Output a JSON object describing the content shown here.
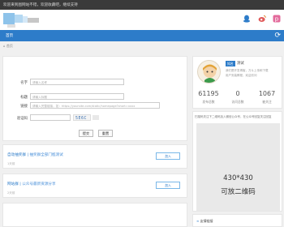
{
  "topbar": {
    "notice": "欢迎来到图网站不错，欢迎收藏吧，继续支持"
  },
  "nav": {
    "home": "首页",
    "refresh_icon": "refresh-icon"
  },
  "breadcrumb": "首页",
  "form": {
    "field1_label": "名字",
    "field1_placeholder": "请输入名称",
    "field2_label": "标题",
    "field2_placeholder": "请输入标题",
    "field3_label": "链接",
    "field3_placeholder": "请输入完整链接，如：https://yoursite.com/static/homepage?short=xxxx",
    "captcha_label": "验证码",
    "captcha_image_text": "5E6C",
    "submit_label": "提交",
    "reset_label": "重置"
  },
  "cards": [
    {
      "title": "自动抽奖群",
      "separator": " | ",
      "subtitle": "抽奖群全部门槛测试",
      "meta": "1天前",
      "action": "加入",
      "color": "#2d7cc9"
    },
    {
      "title": "网站群",
      "separator": " | ",
      "subtitle": "公众号最新资源分享",
      "meta": "2天前",
      "action": "加入",
      "color": "#2d7cc9"
    }
  ],
  "profile": {
    "name": "测试",
    "tag": "知名",
    "bio_line1": "我们是开发博客，万斗上传和下载",
    "bio_line2": "用户安装教程，欢迎访问",
    "stats": [
      {
        "value": "61195",
        "label": "发布总数"
      },
      {
        "value": "0",
        "label": "访问总数"
      },
      {
        "value": "1067",
        "label": "被关注"
      }
    ]
  },
  "qr": {
    "instruction": "扫描码关注下二维码加入微信公众号，在公众号回复关注回复",
    "size_text": "430*430",
    "placeholder_text": "可放二维码"
  },
  "sidebar_footer": {
    "title": "友情链接"
  },
  "colors": {
    "accent": "#2d7cc9",
    "topbar": "#3a3a3a"
  }
}
